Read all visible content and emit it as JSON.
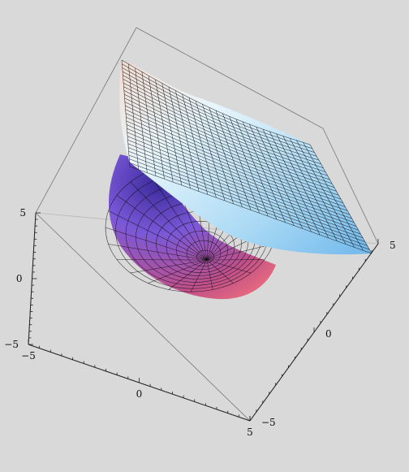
{
  "chart_data": {
    "type": "surface3d",
    "title": "",
    "xlabel": "",
    "ylabel": "",
    "zlabel": "",
    "xlim": [
      -5,
      5
    ],
    "ylim": [
      -5,
      5
    ],
    "zlim": [
      -5,
      5
    ],
    "grid": false,
    "axes": {
      "left_vertical": {
        "ticks": [
          "5",
          "0",
          "−5"
        ]
      },
      "bottom_front": {
        "ticks": [
          "−5",
          "0",
          "5"
        ]
      },
      "right_diagonal": {
        "ticks": [
          "5",
          "0",
          "−5"
        ]
      }
    },
    "surfaces": [
      {
        "role": "bowl",
        "colors": [
          "#3a2a9a",
          "#7a58d8",
          "#c0508a",
          "#f0707a"
        ]
      },
      {
        "role": "sheet",
        "colors": [
          "#f4dcd0",
          "#e8f6fc",
          "#a8d8f4",
          "#70b8ec"
        ]
      }
    ]
  }
}
